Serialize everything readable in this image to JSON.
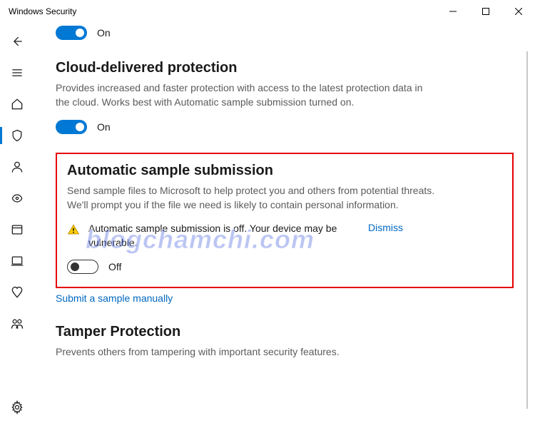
{
  "window": {
    "title": "Windows Security"
  },
  "sections": {
    "realtime": {
      "toggle_state_label": "On"
    },
    "cloud": {
      "heading": "Cloud-delivered protection",
      "desc": "Provides increased and faster protection with access to the latest protection data in the cloud. Works best with Automatic sample submission turned on.",
      "toggle_state_label": "On"
    },
    "auto_sample": {
      "heading": "Automatic sample submission",
      "desc": "Send sample files to Microsoft to help protect you and others from potential threats. We'll prompt you if the file we need is likely to contain personal information.",
      "warning": "Automatic sample submission is off. Your device may be vulnerable.",
      "dismiss": "Dismiss",
      "toggle_state_label": "Off",
      "submit_link": "Submit a sample manually"
    },
    "tamper": {
      "heading": "Tamper Protection",
      "desc": "Prevents others from tampering with important security features."
    }
  },
  "watermark": "blogchamchi.com"
}
